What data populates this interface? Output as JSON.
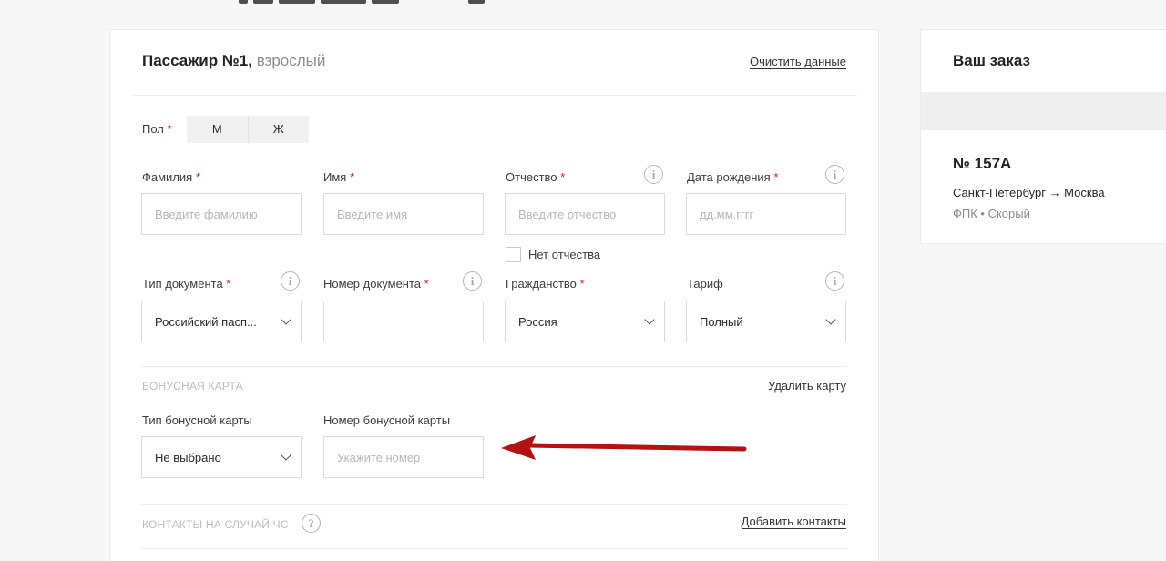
{
  "passenger": {
    "title": "Пассажир №1,",
    "subtitle": "взрослый",
    "clear_link": "Очистить данные",
    "gender": {
      "label": "Пол",
      "options": [
        "М",
        "Ж"
      ]
    },
    "fields": {
      "surname": {
        "label": "Фамилия",
        "placeholder": "Введите фамилию"
      },
      "name": {
        "label": "Имя",
        "placeholder": "Введите имя"
      },
      "patronymic": {
        "label": "Отчество",
        "placeholder": "Введите отчество"
      },
      "birthdate": {
        "label": "Дата рождения",
        "placeholder": "дд.мм.гггг"
      },
      "no_patronymic": "Нет отчества",
      "doc_type": {
        "label": "Тип документа",
        "value": "Российский пасп..."
      },
      "doc_number": {
        "label": "Номер документа",
        "value": ""
      },
      "citizenship": {
        "label": "Гражданство",
        "value": "Россия"
      },
      "tariff": {
        "label": "Тариф",
        "value": "Полный"
      }
    },
    "required_mark": "*",
    "info_glyph": "i",
    "bonus": {
      "section_title": "БОНУСНАЯ КАРТА",
      "remove_link": "Удалить карту",
      "card_type": {
        "label": "Тип бонусной карты",
        "value": "Не выбрано"
      },
      "card_number": {
        "label": "Номер бонусной карты",
        "placeholder": "Укажите номер"
      }
    },
    "emergency": {
      "section_title": "КОНТАКТЫ НА СЛУЧАЙ ЧС",
      "help_glyph": "?",
      "add_link": "Добавить контакты"
    }
  },
  "order": {
    "title": "Ваш заказ",
    "train_number": "№ 157А",
    "route": "Санкт-Петербург → Москва",
    "carrier": "ФПК • Скорый"
  },
  "colors": {
    "required": "#e21a1a",
    "annotation_arrow": "#b31212"
  }
}
